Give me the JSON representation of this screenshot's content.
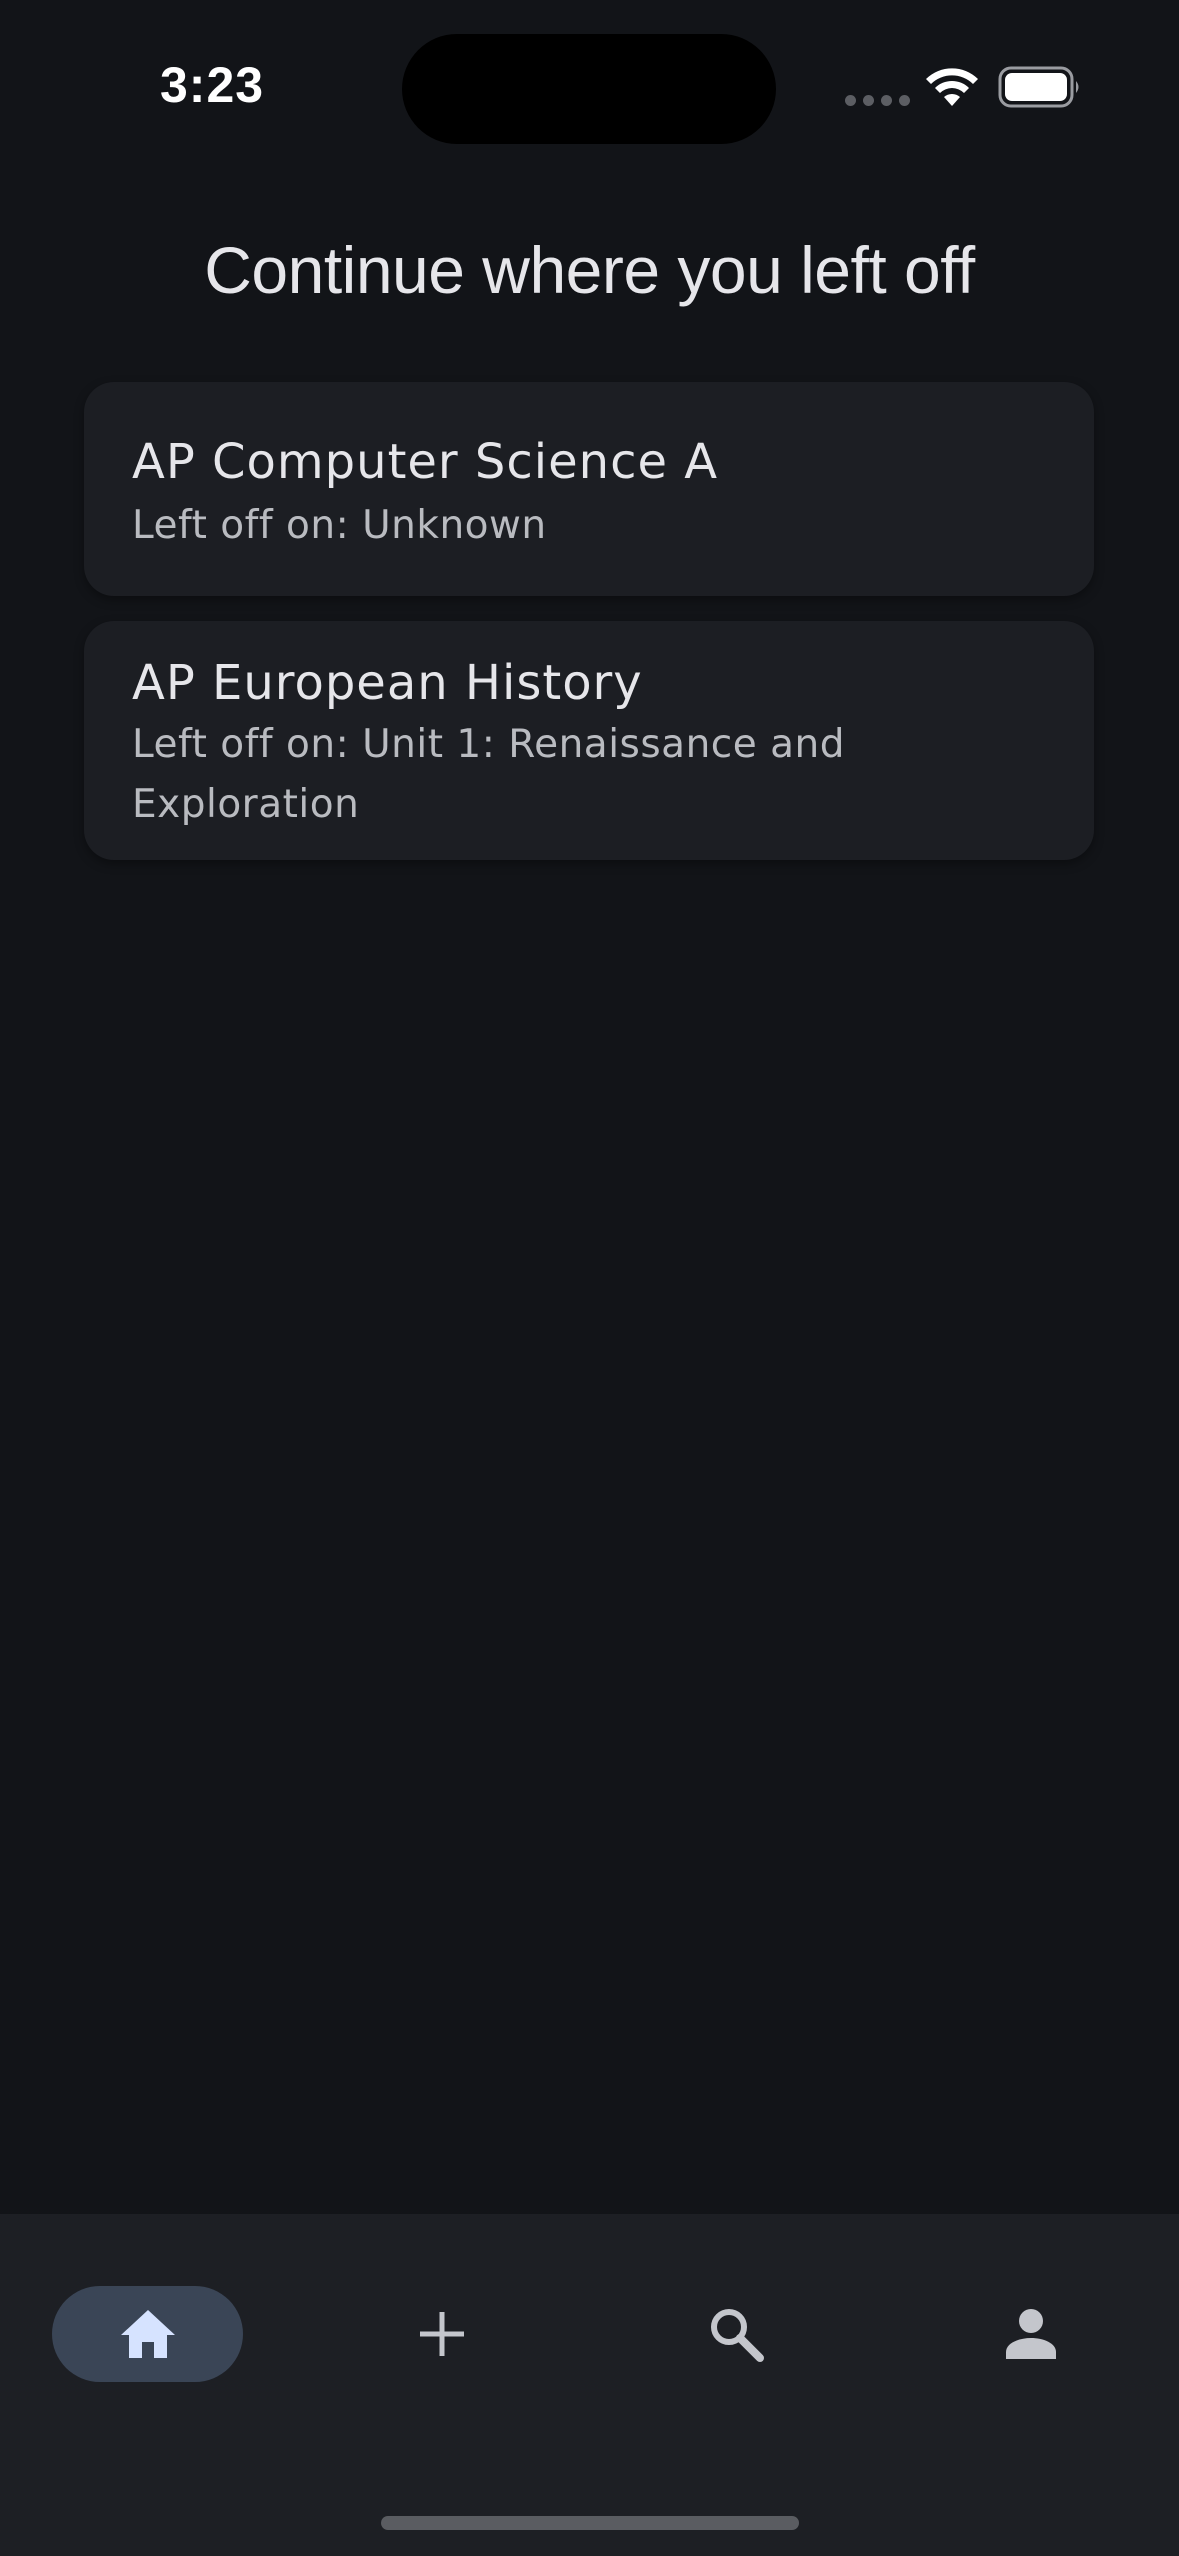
{
  "status_bar": {
    "time": "3:23"
  },
  "page": {
    "title": "Continue where you left off"
  },
  "courses": [
    {
      "title": "AP Computer Science A",
      "left_off": "Left off on: Unknown"
    },
    {
      "title": "AP European History",
      "left_off": "Left off on: Unit 1: Renaissance and Exploration"
    }
  ],
  "bottom_nav": {
    "items": [
      {
        "icon": "home-icon",
        "selected": true
      },
      {
        "icon": "plus-icon",
        "selected": false
      },
      {
        "icon": "search-icon",
        "selected": false
      },
      {
        "icon": "person-icon",
        "selected": false
      }
    ]
  },
  "colors": {
    "background": "#121418",
    "card": "#1c1e23",
    "nav_background": "#1d1f24",
    "nav_selected_pill": "#3a4556",
    "nav_selected_icon": "#d6e3ff",
    "nav_icon": "#c4c6cc"
  }
}
